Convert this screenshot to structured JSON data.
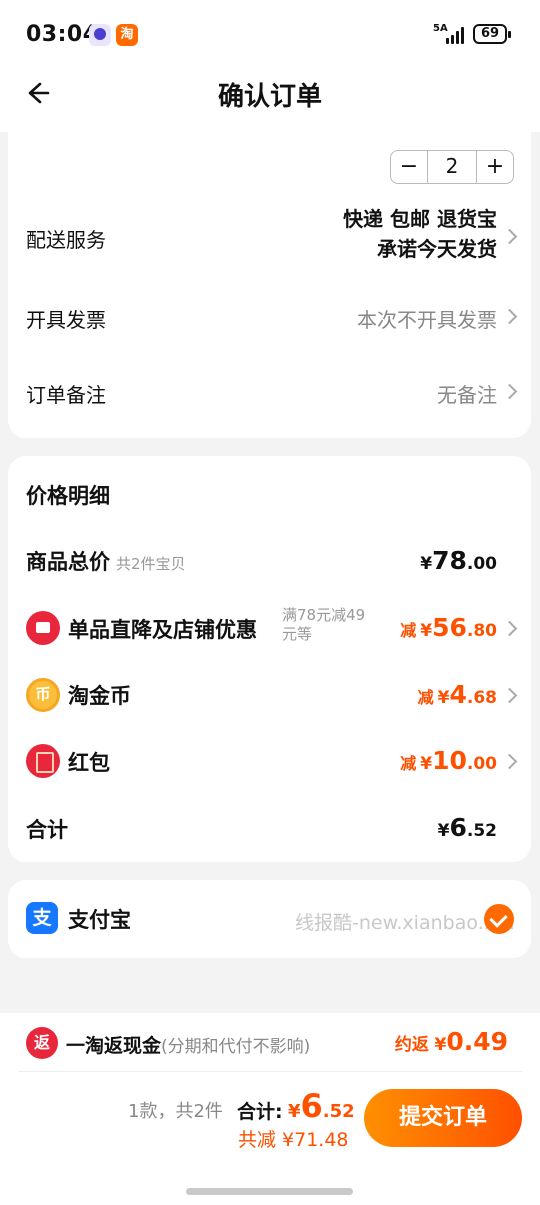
{
  "status_bar": {
    "time": "03:04",
    "app_icon_2": "淘",
    "network": "5A",
    "battery": "69"
  },
  "header": {
    "title": "确认订单"
  },
  "order": {
    "quantity": "2",
    "shipping_label": "配送服务",
    "shipping_line1": "快递 包邮 退货宝",
    "shipping_line2": "承诺今天发货",
    "invoice_label": "开具发票",
    "invoice_value": "本次不开具发票",
    "remark_label": "订单备注",
    "remark_value": "无备注"
  },
  "price_detail": {
    "title": "价格明细",
    "goods_total_label": "商品总价",
    "goods_total_sub": "共2件宝贝",
    "goods_total": {
      "yen": "¥",
      "int": "78",
      "dec": ".00"
    },
    "discount_label": "单品直降及店铺优惠",
    "discount_note_1": "满78元减49",
    "discount_note_2": "元等",
    "discount": {
      "prefix": "减",
      "yen": "¥",
      "int": "56",
      "dec": ".80"
    },
    "coin_label": "淘金币",
    "coin_icon": "币",
    "coin": {
      "prefix": "减",
      "yen": "¥",
      "int": "4",
      "dec": ".68"
    },
    "redpack_label": "红包",
    "redpack": {
      "prefix": "减",
      "yen": "¥",
      "int": "10",
      "dec": ".00"
    },
    "sum_label": "合计",
    "sum": {
      "yen": "¥",
      "int": "6",
      "dec": ".52"
    }
  },
  "payment": {
    "icon_text": "支",
    "label": "支付宝",
    "watermark": "线报酷-new.xianbao.fun"
  },
  "cashback": {
    "badge": "返",
    "label": "一淘返现金",
    "note": "(分期和代付不影响)",
    "prefix": "约返",
    "yen": "¥",
    "value": "0.49"
  },
  "footer": {
    "count": "1款，共2件",
    "total_label": "合计:",
    "total": {
      "yen": "¥",
      "int": "6",
      "dec": ".52"
    },
    "saved": "共减 ¥71.48",
    "submit": "提交订单"
  },
  "colors": {
    "accent": "#ff5000",
    "alipay": "#1677ff",
    "red": "#e8273c"
  }
}
